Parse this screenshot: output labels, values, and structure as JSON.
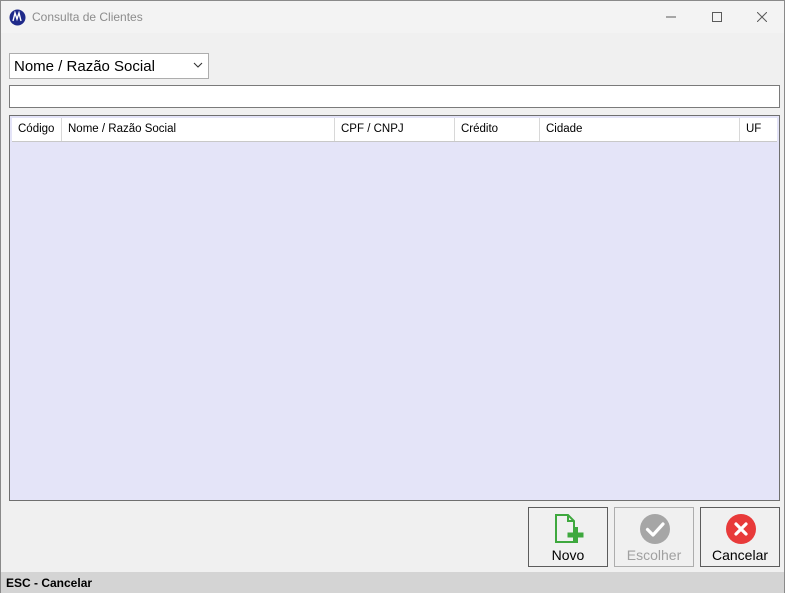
{
  "window": {
    "title": "Consulta de Clientes"
  },
  "search": {
    "type_selected": "Nome / Razão Social",
    "query_value": "",
    "query_placeholder": ""
  },
  "grid": {
    "columns": [
      "Código",
      "Nome / Razão Social",
      "CPF / CNPJ",
      "Crédito",
      "Cidade",
      "UF"
    ],
    "rows": []
  },
  "buttons": {
    "new_label": "Novo",
    "choose_label": "Escolher",
    "cancel_label": "Cancelar"
  },
  "status": {
    "text": "ESC - Cancelar"
  },
  "colors": {
    "grid_background": "#e4e4f8",
    "new_icon": "#3ea83e",
    "choose_icon_disabled": "#a6a6a6",
    "cancel_icon": "#e83a3a"
  },
  "icons": {
    "app": "app-logo-icon",
    "new": "new-document-plus-icon",
    "choose": "check-circle-icon",
    "cancel": "x-circle-icon"
  }
}
